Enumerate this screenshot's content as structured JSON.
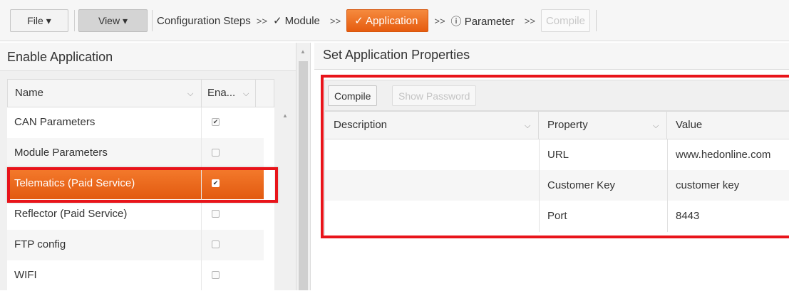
{
  "toolbar": {
    "file_label": "File ▾",
    "view_label": "View ▾",
    "config_steps_label": "Configuration Steps",
    "sep": ">>",
    "step_module": "✓ Module",
    "step_application": "✓ Application",
    "step_parameter": "ⓘ Parameter",
    "step_compile": "Compile"
  },
  "left": {
    "title": "Enable Application",
    "col_name": "Name",
    "col_enabled": "Ena...",
    "rows": [
      {
        "name": "CAN Parameters",
        "check": "✔"
      },
      {
        "name": "Module Parameters",
        "check": ""
      },
      {
        "name": "Telematics (Paid Service)",
        "check": "✔"
      },
      {
        "name": "Reflector (Paid Service)",
        "check": ""
      },
      {
        "name": "FTP config",
        "check": ""
      },
      {
        "name": "WIFI",
        "check": ""
      }
    ]
  },
  "right": {
    "title": "Set Application Properties",
    "compile_label": "Compile",
    "show_password_label": "Show Password",
    "col_description": "Description",
    "col_property": "Property",
    "col_value": "Value",
    "rows": [
      {
        "description": "",
        "property": "URL",
        "value": "www.hedonline.com"
      },
      {
        "description": "",
        "property": "Customer Key",
        "value": "customer key"
      },
      {
        "description": "",
        "property": "Port",
        "value": "8443"
      }
    ]
  },
  "colors": {
    "accent": "#ef6a1a",
    "highlight": "#e8141a"
  }
}
